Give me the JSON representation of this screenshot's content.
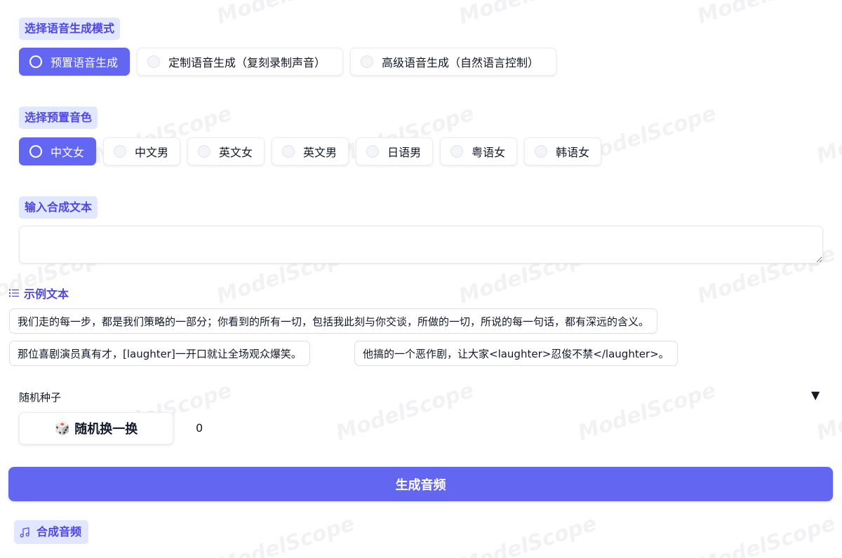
{
  "watermark": "ModelScope",
  "mode_section": {
    "label": "选择语音生成模式",
    "options": [
      {
        "label": "预置语音生成",
        "selected": true
      },
      {
        "label": "定制语音生成（复刻录制声音）",
        "selected": false
      },
      {
        "label": "高级语音生成（自然语言控制）",
        "selected": false
      }
    ]
  },
  "voice_section": {
    "label": "选择预置音色",
    "options": [
      {
        "label": "中文女",
        "selected": true
      },
      {
        "label": "中文男",
        "selected": false
      },
      {
        "label": "英文女",
        "selected": false
      },
      {
        "label": "英文男",
        "selected": false
      },
      {
        "label": "日语男",
        "selected": false
      },
      {
        "label": "粤语女",
        "selected": false
      },
      {
        "label": "韩语女",
        "selected": false
      }
    ]
  },
  "text_section": {
    "label": "输入合成文本",
    "value": ""
  },
  "examples": {
    "header": "示例文本",
    "items": [
      "我们走的每一步，都是我们策略的一部分；你看到的所有一切，包括我此刻与你交谈，所做的一切，所说的每一句话，都有深远的含义。",
      "那位喜剧演员真有才，[laughter]一开口就让全场观众爆笑。",
      "他搞的一个恶作剧，让大家<laughter>忍俊不禁</laughter>。"
    ]
  },
  "seed": {
    "label": "随机种子",
    "toggle_icon": "▼",
    "random_button_icon": "🎲",
    "random_button_label": "随机换一换",
    "value": "0"
  },
  "generate_button_label": "生成音频",
  "audio_output_label": "合成音频",
  "colors": {
    "accent": "#6366f1",
    "label_bg": "#e0e7ff",
    "label_text": "#4f46e5"
  }
}
